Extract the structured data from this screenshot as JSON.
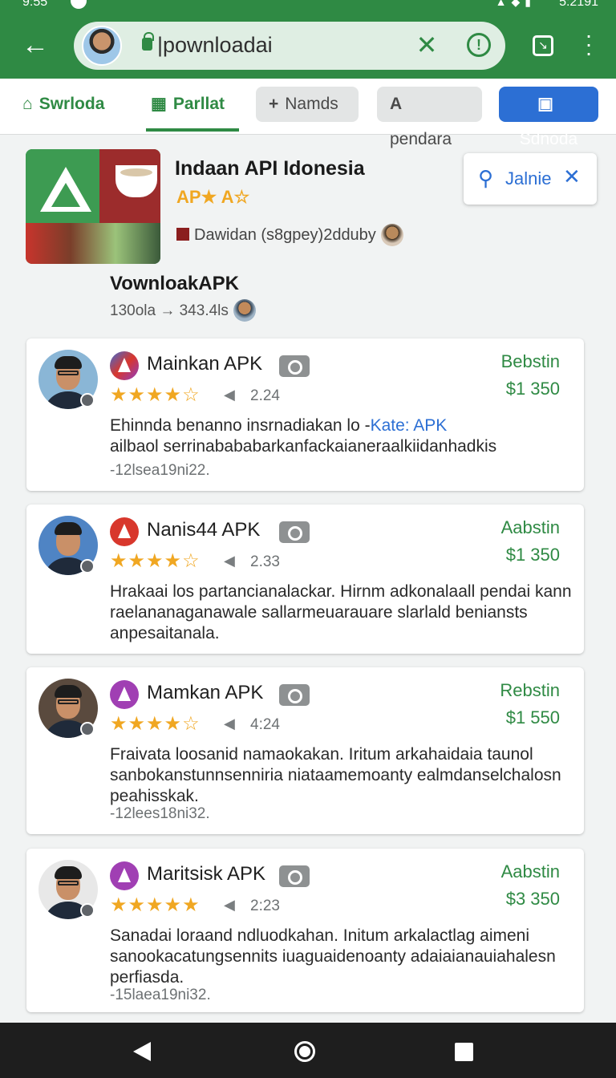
{
  "status_bar": {
    "time_left": "9:55",
    "time_right": "5:2191"
  },
  "browser": {
    "url": "|pownloadai",
    "icons": [
      "back-arrow-icon",
      "lock-icon",
      "close-icon",
      "info-icon",
      "tab-switcher-icon",
      "more-vert-icon"
    ]
  },
  "tabs": [
    {
      "label": "Swrloda",
      "icon": "home-icon",
      "active": false
    },
    {
      "label": "Parllat",
      "icon": "grid-icon",
      "active": true
    },
    {
      "label": "Namds",
      "icon": "plus-icon",
      "active": false
    },
    {
      "label": "pendara",
      "icon": "a-icon",
      "active": false
    },
    {
      "label": "Sdnoda",
      "icon": "store-icon",
      "active": false
    }
  ],
  "app": {
    "title": "Indaan API Idonesia",
    "rating_text": "AP★ A☆",
    "developer": "Dawidan (s8gpey)2dduby",
    "download_title": "VownloakAPK",
    "download_meta": "130ola → 343.4ls"
  },
  "search_card": {
    "label": "Jalnie"
  },
  "reviews": [
    {
      "name": "Mainkan APK",
      "stars": "★★★★☆",
      "count": "2.24",
      "status": "Bebstin",
      "price": "$1 350",
      "text": "Ehinnda benanno insrnadiakan lo -",
      "tag": "Kate: APK",
      "text2": "ailbaol serrinabababarkanfackaianeraalkiidanhadkis",
      "date": "-12lsea19ni22.",
      "icon_color": "#d8372c"
    },
    {
      "name": "Nanis44 APK",
      "stars": "★★★★☆",
      "count": "2.33",
      "status": "Aabstin",
      "price": "$1 350",
      "text": "Hrakaai los partancianalackar. Hirnm adkonalaall pendai kann raelananaganawale sallarmeuarauare slarlald beniansts anpesaitanala.",
      "date": "",
      "icon_color": "#d8372c"
    },
    {
      "name": "Mamkan APK",
      "stars": "★★★★☆",
      "count": "4:24",
      "status": "Rebstin",
      "price": "$1 550",
      "text": "Fraivata loosanid namaokakan. Iritum arkahaidaia taunol sanbokanstunnsenniria niataamemoanty ealmdanselchalosn peahisskak.",
      "date": "-12lees18ni32.",
      "icon_color": "#a03fb3"
    },
    {
      "name": "Maritsisk APK",
      "stars": "★★★★★",
      "count": "2:23",
      "status": "Aabstin",
      "price": "$3 350",
      "text": "Sanadai loraand ndluodkahan. Initum arkalactlag aimeni sanookacatungsennits iuaguaidenoanty adaiaianauiahalesn perfiasda.",
      "date": "-15laea19ni32.",
      "icon_color": "#a03fb3"
    }
  ],
  "nav": {
    "icons": [
      "back-triangle-icon",
      "home-circle-icon",
      "recents-square-icon"
    ]
  }
}
